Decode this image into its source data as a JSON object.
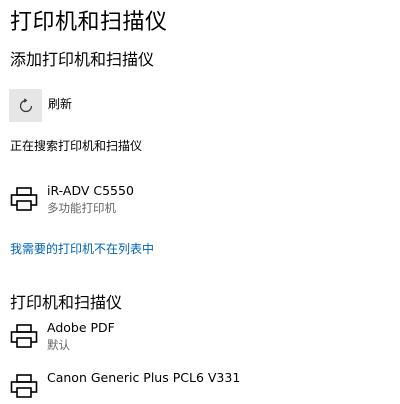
{
  "page": {
    "title": "打印机和扫描仪"
  },
  "add_section": {
    "heading": "添加打印机和扫描仪",
    "refresh_label": "刷新",
    "status_text": "正在搜索打印机和扫描仪",
    "found_devices": [
      {
        "name": "iR-ADV C5550",
        "subtitle": "多功能打印机",
        "icon": "printer-icon"
      }
    ],
    "not_listed_link": "我需要的打印机不在列表中"
  },
  "installed_section": {
    "heading": "打印机和扫描仪",
    "devices": [
      {
        "name": "Adobe PDF",
        "subtitle": "默认",
        "icon": "printer-icon"
      },
      {
        "name": "Canon Generic Plus PCL6 V331",
        "subtitle": "",
        "icon": "printer-icon"
      }
    ]
  },
  "colors": {
    "link": "#0063b1",
    "button_bg": "#e6e6e6",
    "secondary_text": "#666666"
  }
}
